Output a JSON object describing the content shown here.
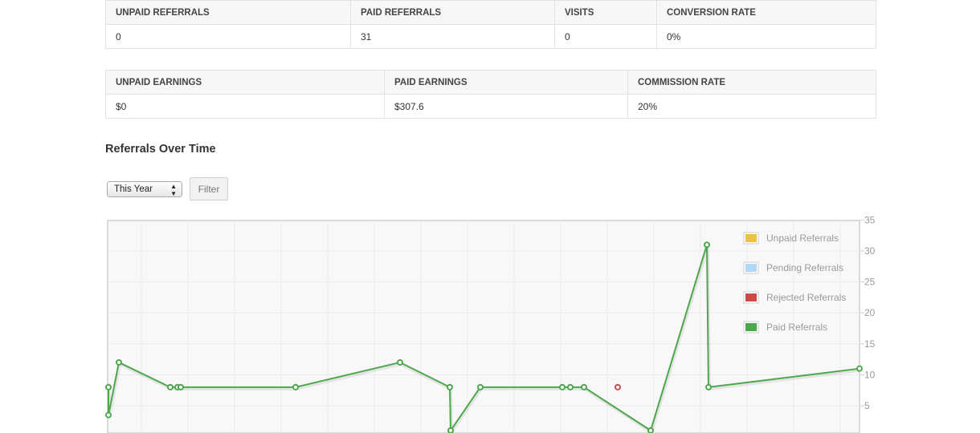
{
  "referral_stats": {
    "headers": [
      "Unpaid Referrals",
      "Paid Referrals",
      "Visits",
      "Conversion Rate"
    ],
    "values": [
      "0",
      "31",
      "0",
      "0%"
    ]
  },
  "earning_stats": {
    "headers": [
      "Unpaid Earnings",
      "Paid Earnings",
      "Commission Rate"
    ],
    "values": [
      "$0",
      "$307.6",
      "20%"
    ]
  },
  "section_title": "Referrals Over Time",
  "filter": {
    "selected": "This Year",
    "button_label": "Filter"
  },
  "chart_data": {
    "type": "line",
    "title": "Referrals Over Time",
    "ylim": [
      0,
      35
    ],
    "y_ticks": [
      5,
      10,
      15,
      20,
      25,
      30,
      35
    ],
    "grid": true,
    "legend_position": "top-right",
    "legend": [
      {
        "name": "Unpaid Referrals",
        "color": "#edc240"
      },
      {
        "name": "Pending Referrals",
        "color": "#afd8f8"
      },
      {
        "name": "Rejected Referrals",
        "color": "#cb4b4b"
      },
      {
        "name": "Paid Referrals",
        "color": "#4da74d"
      }
    ],
    "series": [
      {
        "name": "Paid Referrals",
        "color": "#4da74d",
        "values": [
          8,
          3.5,
          12,
          8,
          8,
          8,
          8,
          12,
          8,
          1,
          8,
          8,
          8,
          8,
          1,
          31,
          8,
          11
        ]
      },
      {
        "name": "Rejected Referrals",
        "color": "#cb4b4b",
        "values": [
          8
        ]
      }
    ]
  }
}
